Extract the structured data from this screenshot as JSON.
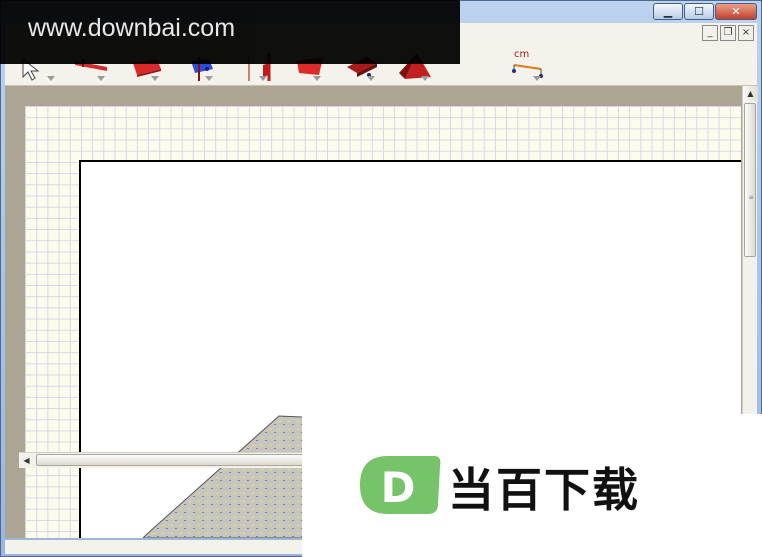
{
  "window": {
    "controls": {
      "minimize": "▁",
      "maximize": "☐",
      "close": "✕"
    },
    "mdi_controls": {
      "minimize": "_",
      "restore": "❐",
      "close": "×"
    }
  },
  "toolbar": {
    "tools": [
      {
        "name": "select-tool",
        "icon": "arrow-cursor-icon"
      },
      {
        "name": "wall-tool",
        "icon": "red-wall-icon"
      },
      {
        "name": "floor-tool",
        "icon": "red-floor-icon"
      },
      {
        "name": "window-tool",
        "icon": "blue-window-icon"
      },
      {
        "name": "door-tool",
        "icon": "red-door-icon"
      },
      {
        "name": "roof-tool",
        "icon": "red-roof-icon"
      },
      {
        "name": "stair-tool",
        "icon": "red-stair-icon"
      },
      {
        "name": "object-tool",
        "icon": "red-pyramid-icon"
      },
      {
        "name": "dimension-tool",
        "icon": "dimension-cm-icon",
        "label": "cm"
      }
    ]
  },
  "colors": {
    "grid": "#fdfbec",
    "grid_line": "#d8d6e6",
    "workspace": "#ada593",
    "badge_green": "#77c36a"
  },
  "watermark": {
    "url": "www.downbai.com",
    "badge_letter": "D",
    "brand": "当百下载"
  }
}
